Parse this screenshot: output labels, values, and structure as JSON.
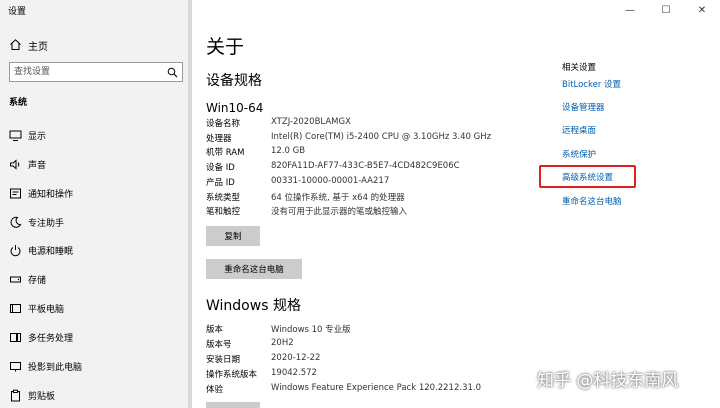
{
  "app_title": "设置",
  "sidebar": {
    "home_label": "主页",
    "search_placeholder": "查找设置",
    "section": "系统",
    "items": [
      {
        "label": "显示",
        "icon": "monitor-icon"
      },
      {
        "label": "声音",
        "icon": "speaker-icon"
      },
      {
        "label": "通知和操作",
        "icon": "notification-icon"
      },
      {
        "label": "专注助手",
        "icon": "moon-icon"
      },
      {
        "label": "电源和睡眠",
        "icon": "power-icon"
      },
      {
        "label": "存储",
        "icon": "storage-icon"
      },
      {
        "label": "平板电脑",
        "icon": "tablet-icon"
      },
      {
        "label": "多任务处理",
        "icon": "multitask-icon"
      },
      {
        "label": "投影到此电脑",
        "icon": "projector-icon"
      },
      {
        "label": "剪贴板",
        "icon": "clipboard-icon"
      }
    ]
  },
  "window_controls": {
    "minimize": "—",
    "maximize": "☐",
    "close": "✕"
  },
  "main": {
    "title": "关于",
    "device_spec_heading": "设备规格",
    "device_name": "Win10-64",
    "specs": [
      {
        "k": "设备名称",
        "v": "XTZJ-2020BLAMGX"
      },
      {
        "k": "处理器",
        "v": "Intel(R) Core(TM) i5-2400 CPU @ 3.10GHz   3.40 GHz"
      },
      {
        "k": "机带 RAM",
        "v": "12.0 GB"
      },
      {
        "k": "设备 ID",
        "v": "820FA11D-AF77-433C-B5E7-4CD482C9E06C"
      },
      {
        "k": "产品 ID",
        "v": "00331-10000-00001-AA217"
      },
      {
        "k": "系统类型",
        "v": "64 位操作系统, 基于 x64 的处理器"
      },
      {
        "k": "笔和触控",
        "v": "没有可用于此显示器的笔或触控输入"
      }
    ],
    "copy_button": "复制",
    "rename_button": "重命名这台电脑",
    "windows_spec_heading": "Windows 规格",
    "win_specs": [
      {
        "k": "版本",
        "v": "Windows 10 专业版"
      },
      {
        "k": "版本号",
        "v": "20H2"
      },
      {
        "k": "安装日期",
        "v": "2020-12-22"
      },
      {
        "k": "操作系统版本",
        "v": "19042.572"
      },
      {
        "k": "体验",
        "v": "Windows Feature Experience Pack 120.2212.31.0"
      }
    ]
  },
  "related": {
    "title": "相关设置",
    "links": [
      "BitLocker 设置",
      "设备管理器",
      "远程桌面",
      "系统保护",
      "高级系统设置",
      "重命名这台电脑"
    ]
  },
  "watermark": "知乎 @科技东南风",
  "colors": {
    "link": "#0060b0",
    "highlight": "#e02020",
    "sidebar_bg": "#f2f2f2"
  }
}
